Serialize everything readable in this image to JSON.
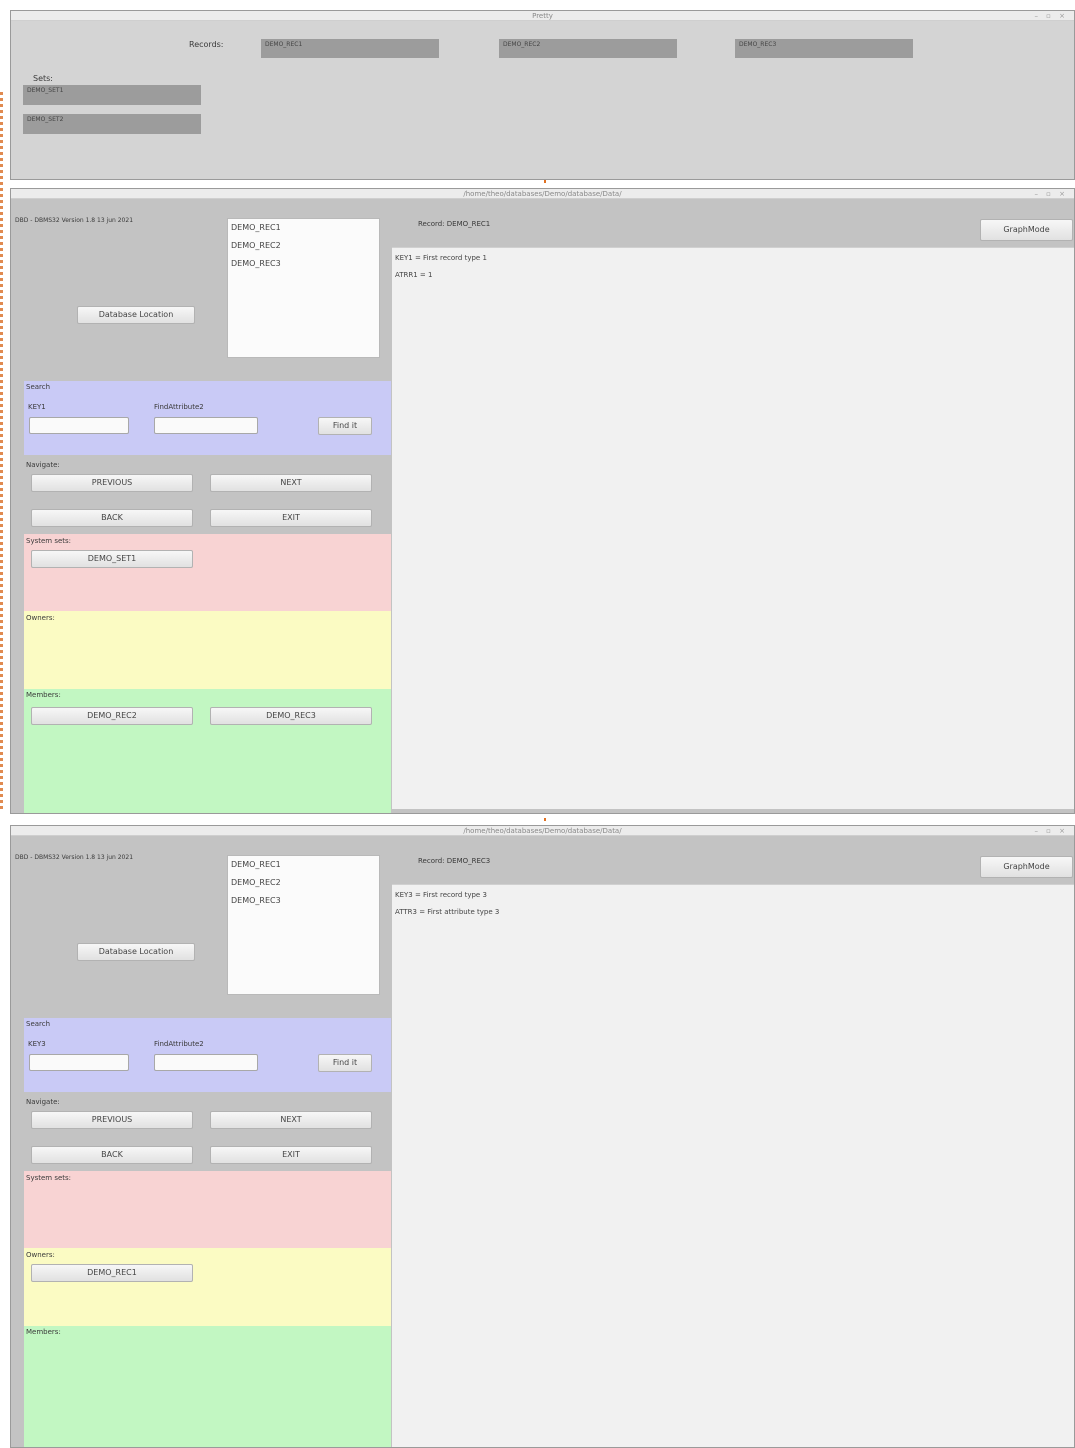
{
  "overview": {
    "title": "Pretty",
    "records_label": "Records:",
    "records": [
      "DEMO_REC1",
      "DEMO_REC2",
      "DEMO_REC3"
    ],
    "sets_label": "Sets:",
    "sets": [
      "DEMO_SET1",
      "DEMO_SET2"
    ]
  },
  "app1": {
    "title": "/home/theo/databases/Demo/database/Data/",
    "version_info": "DBD - DBMS32   Version 1.8   13 jun 2021",
    "record_list": [
      "DEMO_REC1",
      "DEMO_REC2",
      "DEMO_REC3"
    ],
    "db_location_button": "Database Location",
    "record_header": "Record: DEMO_REC1",
    "graphmode_button": "GraphMode",
    "content_lines": [
      "KEY1 = First record type 1",
      "ATRR1 = 1"
    ],
    "search": {
      "title": "Search",
      "key_label": "KEY1",
      "find_attr_label": "FindAttribute2",
      "find_button": "Find it"
    },
    "navigate": {
      "title": "Navigate:",
      "previous": "PREVIOUS",
      "next": "NEXT",
      "back": "BACK",
      "exit": "EXIT"
    },
    "system_sets_label": "System sets:",
    "system_sets": [
      "DEMO_SET1"
    ],
    "owners_label": "Owners:",
    "owners": [],
    "members_label": "Members:",
    "members": [
      "DEMO_REC2",
      "DEMO_REC3"
    ]
  },
  "app2": {
    "title": "/home/theo/databases/Demo/database/Data/",
    "version_info": "DBD - DBMS32   Version 1.8   13 jun 2021",
    "record_list": [
      "DEMO_REC1",
      "DEMO_REC2",
      "DEMO_REC3"
    ],
    "db_location_button": "Database Location",
    "record_header": "Record: DEMO_REC3",
    "graphmode_button": "GraphMode",
    "content_lines": [
      "KEY3 = First record type 3",
      "ATTR3 = First attribute type 3"
    ],
    "search": {
      "title": "Search",
      "key_label": "KEY3",
      "find_attr_label": "FindAttribute2",
      "find_button": "Find it"
    },
    "navigate": {
      "title": "Navigate:",
      "previous": "PREVIOUS",
      "next": "NEXT",
      "back": "BACK",
      "exit": "EXIT"
    },
    "system_sets_label": "System sets:",
    "system_sets": [],
    "owners_label": "Owners:",
    "owners": [
      "DEMO_REC1"
    ],
    "members_label": "Members:",
    "members": []
  },
  "colors": {
    "search_panel": "#c9caf6",
    "system_sets_panel": "#f8d3d3",
    "owners_panel": "#fbfbc3",
    "members_panel": "#c2f7c2",
    "gray_chip": "#9c9c9c",
    "window_bg": "#c3c3c3",
    "accent_marker": "#e07020"
  }
}
